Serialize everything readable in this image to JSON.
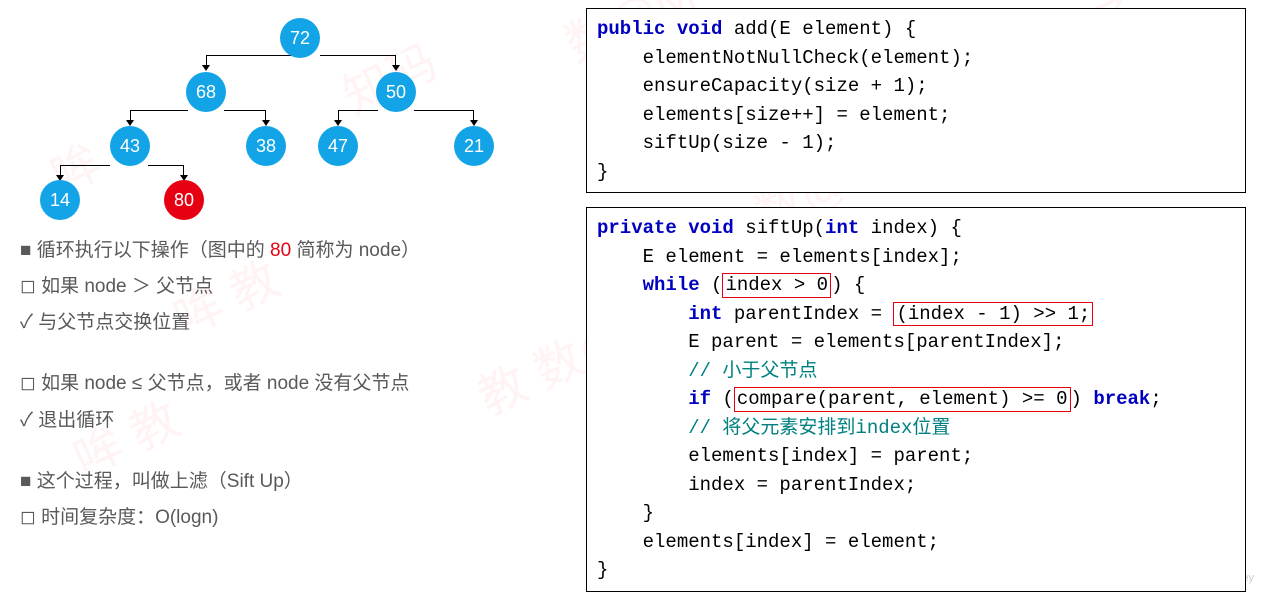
{
  "tree": {
    "nodes": {
      "n72": "72",
      "n68": "68",
      "n50": "50",
      "n43": "43",
      "n38": "38",
      "n47": "47",
      "n21": "21",
      "n14": "14",
      "n80": "80"
    }
  },
  "notes": {
    "line1a": "循环执行以下操作（图中的 ",
    "line1_red": "80",
    "line1b": " 简称为 node）",
    "line2": "如果 node ＞ 父节点",
    "line3": "与父节点交换位置",
    "line4": "如果 node ≤ 父节点，或者 node 没有父节点",
    "line5": "退出循环",
    "line6": "这个过程，叫做上滤（Sift Up）",
    "line7": "时间复杂度：O(logn)"
  },
  "code1": {
    "sig_pre": "public void",
    "sig_name": " add(E element) {",
    "l1": "    elementNotNullCheck(element);",
    "l2a": "    ensureCapacity(size + ",
    "l2_num": "1",
    "l2b": ");",
    "l3": "    elements[size++] = element;",
    "l4a": "    siftUp(size - ",
    "l4_num": "1",
    "l4b": ");",
    "close": "}"
  },
  "code2": {
    "sig_pre": "private void",
    "sig_mid": " siftUp(",
    "sig_int": "int",
    "sig_post": " index) {",
    "l1": "    E element = elements[index];",
    "l2a": "    ",
    "l2_while": "while",
    "l2b": " (",
    "l2_hl": "index > 0",
    "l2c": ") {",
    "l3a": "        ",
    "l3_int": "int",
    "l3b": " parentIndex = ",
    "l3_hl": "(index - 1) >> 1;",
    "l4": "        E parent = elements[parentIndex];",
    "l5": "        // 小于父节点",
    "l6a": "        ",
    "l6_if": "if",
    "l6b": " (",
    "l6_hl": "compare(parent, element) >= 0",
    "l6c": ") ",
    "l6_break": "break",
    "l6d": ";",
    "l7": "        // 将父元素安排到index位置",
    "l8": "        elements[index] = parent;",
    "l9": "        index = parentIndex;",
    "l10": "    }",
    "l11": "    elements[index] = element;",
    "close": "}"
  },
  "csdn": "https://blog.csdn.net/Mind_programmonkey"
}
